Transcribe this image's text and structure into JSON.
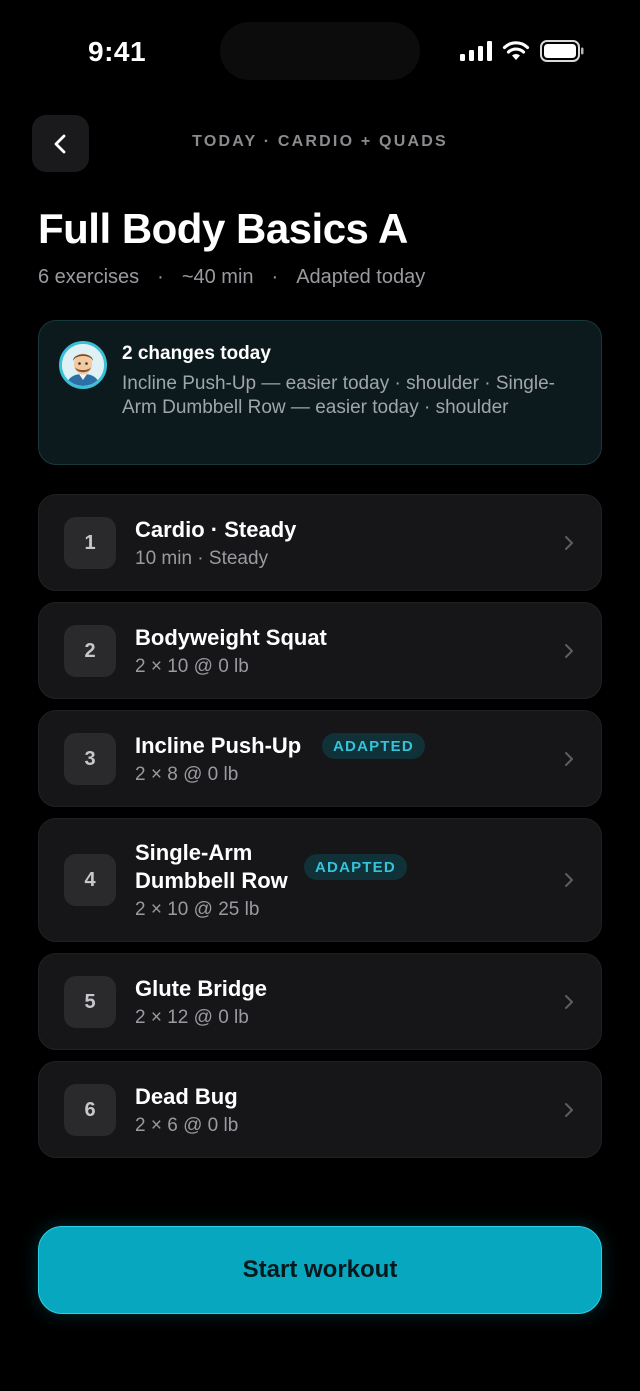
{
  "status_bar": {
    "time": "9:41"
  },
  "header": {
    "breadcrumb": "TODAY · CARDIO + QUADS"
  },
  "workout": {
    "title": "Full Body Basics A",
    "meta": {
      "exercises": "6 exercises",
      "duration": "~40 min",
      "note": "Adapted today",
      "separator": "·"
    }
  },
  "changes": {
    "title": "2 changes today",
    "body": "Incline Push-Up — easier today · shoulder · Single-Arm Dumbbell Row — easier today · shoulder"
  },
  "exercises": [
    {
      "num": "1",
      "name": "Cardio · Steady",
      "detail": "10 min · Steady",
      "badge": ""
    },
    {
      "num": "2",
      "name": "Bodyweight Squat",
      "detail": "2 × 10 @ 0 lb",
      "badge": ""
    },
    {
      "num": "3",
      "name": "Incline Push-Up",
      "detail": "2 × 8 @ 0 lb",
      "badge": "ADAPTED"
    },
    {
      "num": "4",
      "name": "Single-Arm\nDumbbell Row",
      "detail": "2 × 10 @ 25 lb",
      "badge": "ADAPTED"
    },
    {
      "num": "5",
      "name": "Glute Bridge",
      "detail": "2 × 12 @ 0 lb",
      "badge": ""
    },
    {
      "num": "6",
      "name": "Dead Bug",
      "detail": "2 × 6 @ 0 lb",
      "badge": ""
    }
  ],
  "cta": {
    "label": "Start workout"
  },
  "colors": {
    "accent": "#08a7c0",
    "badge_text": "#34c3d8",
    "card": "#161618",
    "background": "#000000"
  },
  "icons": {
    "back": "chevron-left-icon",
    "row": "chevron-right-icon",
    "status": [
      "signal-icon",
      "wifi-icon",
      "battery-icon"
    ]
  }
}
